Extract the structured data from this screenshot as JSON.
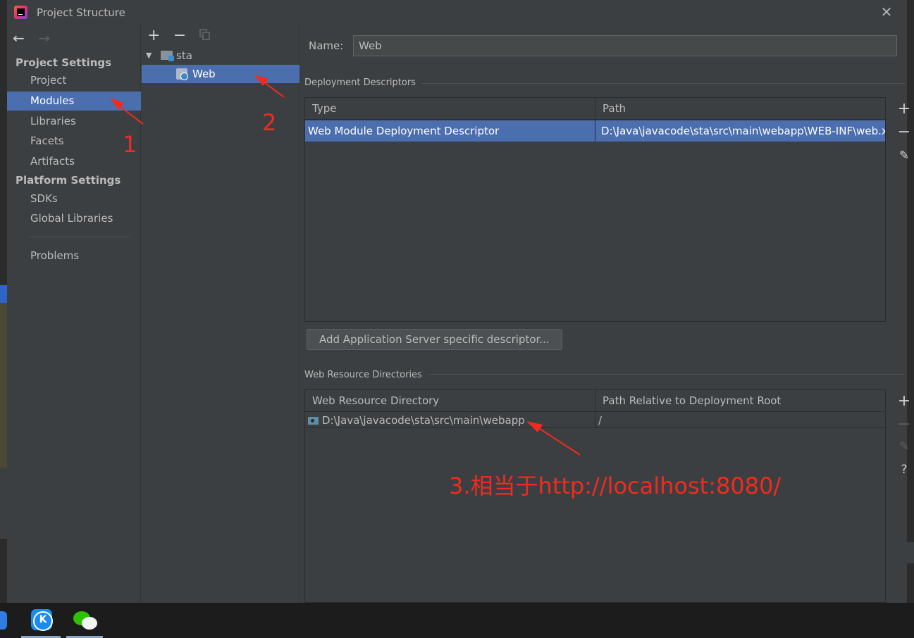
{
  "window": {
    "title": "Project Structure",
    "close_glyph": "✕"
  },
  "nav": {
    "back": "←",
    "forward": "→"
  },
  "sidebar": {
    "group1": "Project Settings",
    "items1": [
      "Project",
      "Modules",
      "Libraries",
      "Facets",
      "Artifacts"
    ],
    "group2": "Platform Settings",
    "items2": [
      "SDKs",
      "Global Libraries"
    ],
    "problems": "Problems",
    "selected": "Modules"
  },
  "module_tree": {
    "toolbar": {
      "add": "+",
      "remove": "−"
    },
    "root": {
      "toggle": "▼",
      "label": "sta"
    },
    "child": {
      "label": "Web",
      "selected": true
    }
  },
  "content": {
    "name_label": "Name:",
    "name_value": "Web",
    "deployment": {
      "title": "Deployment Descriptors",
      "columns": [
        "Type",
        "Path"
      ],
      "rows": [
        {
          "type": "Web Module Deployment Descriptor",
          "path": "D:\\Java\\javacode\\sta\\src\\main\\webapp\\WEB-INF\\web.xml"
        }
      ],
      "tools": {
        "add": "+",
        "remove": "−",
        "edit": "✎"
      },
      "add_button": "Add Application Server specific descriptor..."
    },
    "web_resources": {
      "title": "Web Resource Directories",
      "columns": [
        "Web Resource Directory",
        "Path Relative to Deployment Root"
      ],
      "rows": [
        {
          "directory": "D:\\Java\\javacode\\sta\\src\\main\\webapp",
          "relative": "/"
        }
      ],
      "tools": {
        "add": "+",
        "remove": "−",
        "edit": "✎",
        "help": "?"
      }
    }
  },
  "annotations": {
    "n1": "1",
    "n2": "2",
    "n3": "3.相当于http://localhost:8080/",
    "color": "#f22a1f"
  },
  "taskbar": {
    "apps": [
      "kugou-music",
      "wechat"
    ]
  },
  "colors": {
    "selection": "#4b6eaf",
    "panel": "#3c3f41",
    "text": "#bbbbbb"
  }
}
